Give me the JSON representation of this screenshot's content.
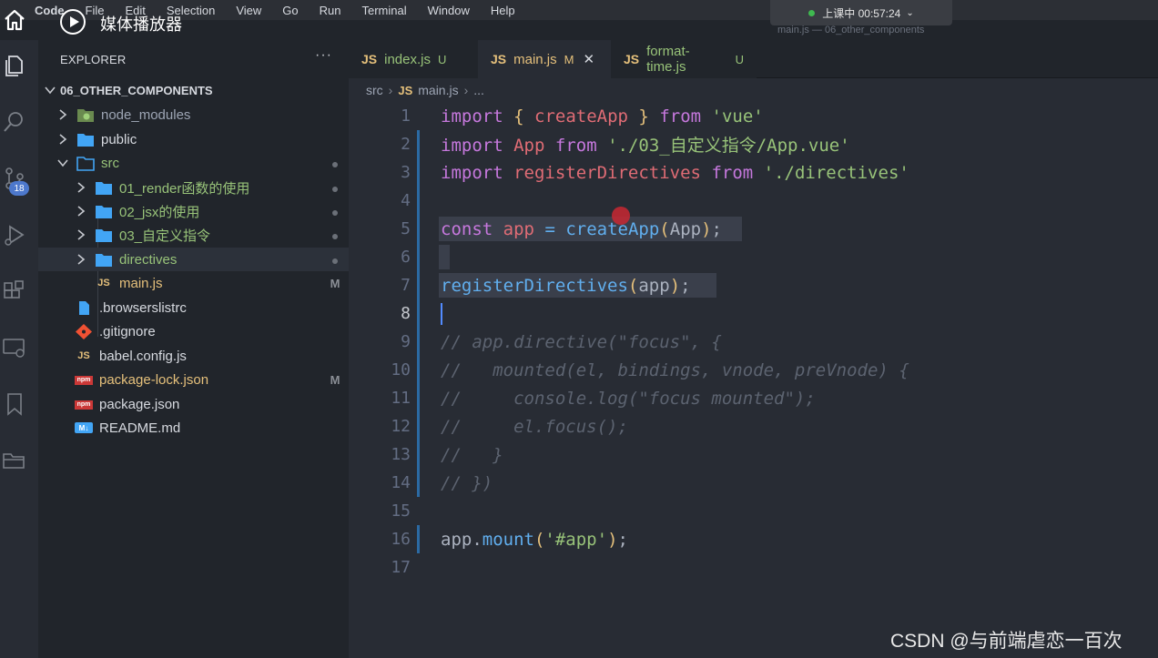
{
  "menubar": {
    "items": [
      "Code",
      "File",
      "Edit",
      "Selection",
      "View",
      "Go",
      "Run",
      "Terminal",
      "Window",
      "Help"
    ]
  },
  "class_status": "上课中 00:57:24",
  "window_title": "main.js — 06_other_components",
  "media_player": {
    "title": "媒体播放器"
  },
  "activity_bar": {
    "scm_badge": "18"
  },
  "explorer": {
    "title": "EXPLORER",
    "more": "···",
    "project": "06_OTHER_COMPONENTS",
    "items": [
      {
        "name": "node_modules",
        "mark": ""
      },
      {
        "name": "public",
        "mark": ""
      },
      {
        "name": "src",
        "mark": ""
      },
      {
        "name": "01_render函数的使用",
        "mark": ""
      },
      {
        "name": "02_jsx的使用",
        "mark": ""
      },
      {
        "name": "03_自定义指令",
        "mark": ""
      },
      {
        "name": "directives",
        "mark": ""
      },
      {
        "name": "main.js",
        "mark": "M"
      },
      {
        "name": ".browserslistrc",
        "mark": ""
      },
      {
        "name": ".gitignore",
        "mark": ""
      },
      {
        "name": "babel.config.js",
        "mark": ""
      },
      {
        "name": "package-lock.json",
        "mark": "M"
      },
      {
        "name": "package.json",
        "mark": ""
      },
      {
        "name": "README.md",
        "mark": ""
      }
    ],
    "file_badges": {
      "js": "JS",
      "npm": "npm",
      "md": "M↓"
    }
  },
  "tabs": [
    {
      "name": "index.js",
      "status": "U"
    },
    {
      "name": "main.js",
      "status": "M",
      "close": "✕"
    },
    {
      "name": "format-time.js",
      "status": "U"
    }
  ],
  "breadcrumb": {
    "folder": "src",
    "file": "main.js",
    "tail": "..."
  },
  "code_lines": [
    [
      [
        "kw",
        "import"
      ],
      [
        "tx",
        " "
      ],
      [
        "br",
        "{"
      ],
      [
        "tx",
        " "
      ],
      [
        "id",
        "createApp"
      ],
      [
        "tx",
        " "
      ],
      [
        "br",
        "}"
      ],
      [
        "tx",
        " "
      ],
      [
        "kw",
        "from"
      ],
      [
        "tx",
        " "
      ],
      [
        "str",
        "'vue'"
      ]
    ],
    [
      [
        "kw",
        "import"
      ],
      [
        "tx",
        " "
      ],
      [
        "id",
        "App"
      ],
      [
        "tx",
        " "
      ],
      [
        "kw",
        "from"
      ],
      [
        "tx",
        " "
      ],
      [
        "str",
        "'./03_自定义指令/App.vue'"
      ]
    ],
    [
      [
        "kw",
        "import"
      ],
      [
        "tx",
        " "
      ],
      [
        "id",
        "registerDirectives"
      ],
      [
        "tx",
        " "
      ],
      [
        "kw",
        "from"
      ],
      [
        "tx",
        " "
      ],
      [
        "str",
        "'./directives'"
      ]
    ],
    [],
    [
      [
        "kw",
        "const"
      ],
      [
        "tx",
        " "
      ],
      [
        "id",
        "app"
      ],
      [
        "tx",
        " "
      ],
      [
        "fn",
        "="
      ],
      [
        "tx",
        " "
      ],
      [
        "fn",
        "createApp"
      ],
      [
        "br",
        "("
      ],
      [
        "tx",
        "App"
      ],
      [
        "br",
        ")"
      ],
      [
        "tx",
        ";"
      ]
    ],
    [],
    [
      [
        "fn",
        "registerDirectives"
      ],
      [
        "br",
        "("
      ],
      [
        "tx",
        "app"
      ],
      [
        "br",
        ")"
      ],
      [
        "tx",
        ";"
      ]
    ],
    [],
    [
      [
        "cm",
        "// app.directive(\"focus\", {"
      ]
    ],
    [
      [
        "cm",
        "//   mounted(el, bindings, vnode, preVnode) {"
      ]
    ],
    [
      [
        "cm",
        "//     console.log(\"focus mounted\");"
      ]
    ],
    [
      [
        "cm",
        "//     el.focus();"
      ]
    ],
    [
      [
        "cm",
        "//   }"
      ]
    ],
    [
      [
        "cm",
        "// })"
      ]
    ],
    [],
    [
      [
        "tx",
        "app."
      ],
      [
        "fn",
        "mount"
      ],
      [
        "br",
        "("
      ],
      [
        "str",
        "'#app'"
      ],
      [
        "br",
        ")"
      ],
      [
        "tx",
        ";"
      ]
    ],
    []
  ],
  "line_numbers": [
    "1",
    "2",
    "3",
    "4",
    "5",
    "6",
    "7",
    "8",
    "9",
    "10",
    "11",
    "12",
    "13",
    "14",
    "15",
    "16",
    "17"
  ],
  "watermark": "CSDN @与前端虐恋一百次"
}
